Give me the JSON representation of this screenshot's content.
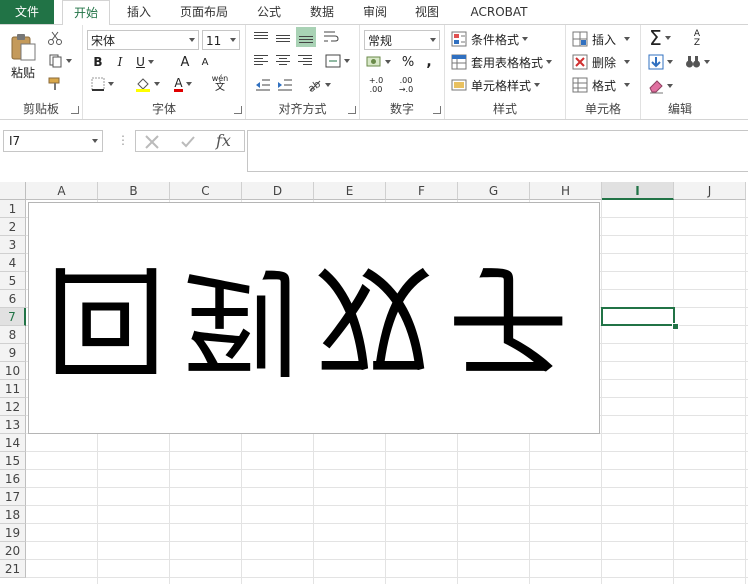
{
  "tabs": [
    "文件",
    "开始",
    "插入",
    "页面布局",
    "公式",
    "数据",
    "审阅",
    "视图",
    "ACROBAT"
  ],
  "ribbon": {
    "clipboard": {
      "paste": "粘贴",
      "group": "剪贴板"
    },
    "font": {
      "name": "宋体",
      "size": "11",
      "bold": "B",
      "italic": "I",
      "underline": "U",
      "grow": "A",
      "shrink": "A",
      "font_color": "A",
      "phonetic": "wén",
      "phonetic_sub": "文",
      "group": "字体"
    },
    "alignment": {
      "group": "对齐方式"
    },
    "number": {
      "format": "常规",
      "percent": "%",
      "comma": ",",
      "inc": "+.0",
      "inc2": ".00",
      "dec": ".00",
      "dec2": "→.0",
      "group": "数字"
    },
    "styles": {
      "conditional": "条件格式",
      "table": "套用表格格式",
      "cell": "单元格样式",
      "group": "样式"
    },
    "cells": {
      "insert": "插入",
      "delete": "删除",
      "format": "格式",
      "group": "单元格"
    },
    "editing": {
      "sum": "Σ",
      "sort": "A",
      "sort2": "Z",
      "group": "编辑"
    }
  },
  "formula_bar": {
    "name_box": "I7",
    "fx": "fx",
    "formula": ""
  },
  "columns": [
    "A",
    "B",
    "C",
    "D",
    "E",
    "F",
    "G",
    "H",
    "I",
    "J"
  ],
  "rows": [
    "1",
    "2",
    "3",
    "4",
    "5",
    "6",
    "7",
    "8",
    "9",
    "10",
    "11",
    "12",
    "13",
    "14",
    "15",
    "16",
    "17",
    "18",
    "19",
    "20",
    "21"
  ],
  "selected_cell": {
    "column": "I",
    "row": "7"
  },
  "picture_text": "回到双子",
  "colors": {
    "accent": "#217346",
    "header_bg": "#f3f3f3",
    "grid_line": "#e3e3e3"
  }
}
